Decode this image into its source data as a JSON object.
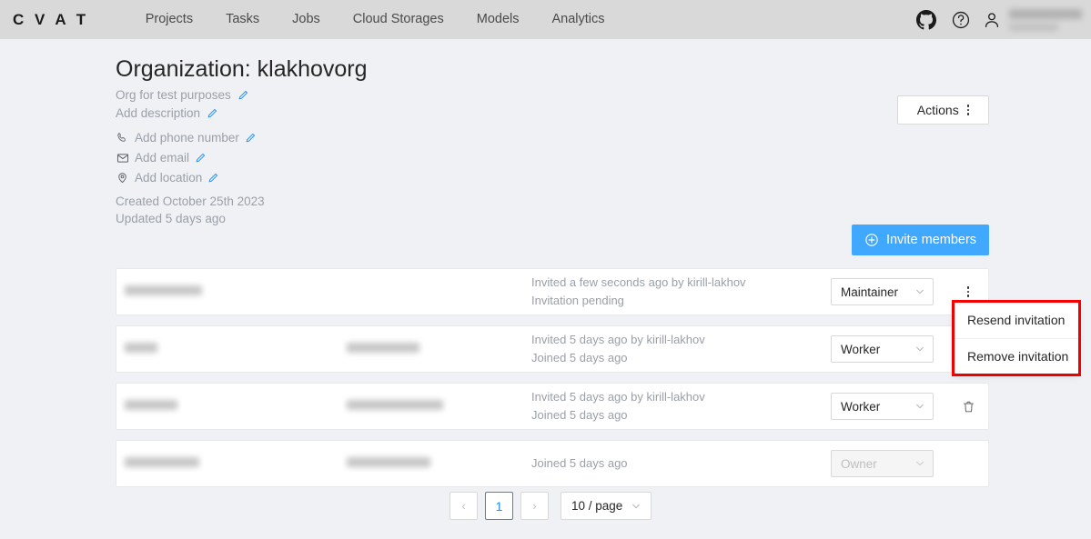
{
  "header": {
    "logo": "C V A T",
    "nav": [
      {
        "label": "Projects",
        "name": "nav-projects"
      },
      {
        "label": "Tasks",
        "name": "nav-tasks"
      },
      {
        "label": "Jobs",
        "name": "nav-jobs"
      },
      {
        "label": "Cloud Storages",
        "name": "nav-cloud-storages"
      },
      {
        "label": "Models",
        "name": "nav-models"
      },
      {
        "label": "Analytics",
        "name": "nav-analytics"
      }
    ],
    "icons": {
      "github": "github-icon",
      "help": "question-circle-icon",
      "user": "user-avatar-icon"
    },
    "user": {
      "name_redacted": "",
      "sub_redacted": ""
    }
  },
  "organization": {
    "title": "Organization: klakhovorg",
    "full_name": "Org for test purposes",
    "description_placeholder": "Add description",
    "phone_placeholder": "Add phone number",
    "email_placeholder": "Add email",
    "location_placeholder": "Add location",
    "created": "Created October 25th 2023",
    "updated": "Updated 5 days ago"
  },
  "toolbar": {
    "actions_label": "Actions",
    "invite_label": "Invite members"
  },
  "members": [
    {
      "username_redacted": "",
      "username_width": 85,
      "fullname_redacted": "",
      "fullname_width": 0,
      "invited": "Invited a few seconds ago by kirill-lakhov",
      "status": "Invitation pending",
      "role": "Maintainer",
      "role_disabled": false,
      "action": "more-menu"
    },
    {
      "username_redacted": "",
      "username_width": 36,
      "fullname_redacted": "",
      "fullname_width": 80,
      "invited": "Invited 5 days ago by kirill-lakhov",
      "status": "Joined 5 days ago",
      "role": "Worker",
      "role_disabled": false,
      "action": "more-menu"
    },
    {
      "username_redacted": "",
      "username_width": 58,
      "fullname_redacted": "",
      "fullname_width": 106,
      "invited": "Invited 5 days ago by kirill-lakhov",
      "status": "Joined 5 days ago",
      "role": "Worker",
      "role_disabled": false,
      "action": "delete"
    },
    {
      "username_redacted": "",
      "username_width": 82,
      "fullname_redacted": "",
      "fullname_width": 92,
      "invited": "",
      "status": "Joined 5 days ago",
      "role": "Owner",
      "role_disabled": true,
      "action": "none"
    }
  ],
  "context_menu": {
    "highlight_color": "#ff0000",
    "items": [
      {
        "label": "Resend invitation",
        "name": "resend-invitation-item"
      },
      {
        "label": "Remove invitation",
        "name": "remove-invitation-item"
      }
    ]
  },
  "pagination": {
    "prev": "‹",
    "current_page": "1",
    "next": "›",
    "page_size": "10 / page"
  },
  "colors": {
    "accent": "#1890ff",
    "primary_button": "#40a9ff",
    "page_background": "#f0f1f5",
    "header_background": "#d9d9d9",
    "muted_text": "#9a9fa8"
  }
}
